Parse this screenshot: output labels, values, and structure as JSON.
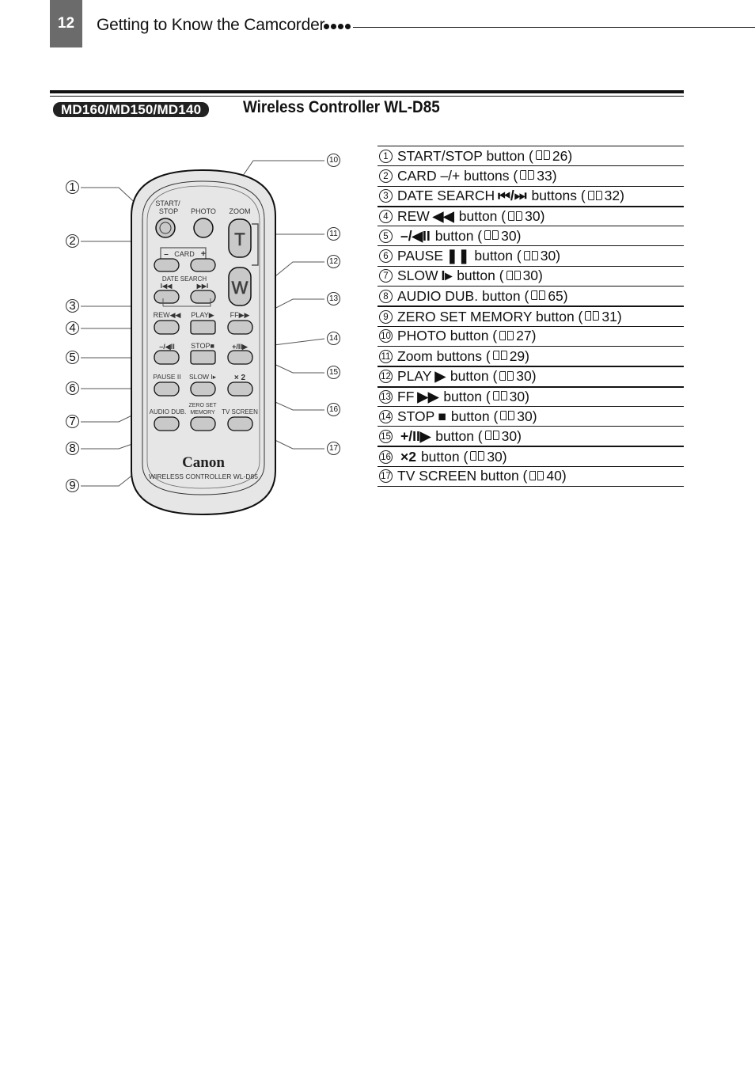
{
  "header": {
    "page_number": "12",
    "running_head": "Getting to Know the Camcorder"
  },
  "section": {
    "model_badge": "MD160/MD150/MD140",
    "title": "Wireless Controller WL-D85"
  },
  "items": [
    {
      "num": "1",
      "pre": "START/STOP button (",
      "symbol": "",
      "post": "",
      "page": "26"
    },
    {
      "num": "2",
      "pre": "CARD –/+ buttons (",
      "symbol": "",
      "post": "",
      "page": "33"
    },
    {
      "num": "3",
      "pre": "DATE SEARCH",
      "symbol": "⏮/⏭",
      "post": "buttons (",
      "page": "32"
    },
    {
      "num": "4",
      "pre": "REW",
      "symbol": "◀◀",
      "post": "button (",
      "page": "30"
    },
    {
      "num": "5",
      "pre": "",
      "symbol": "–/◀II",
      "post": "button (",
      "page": "30"
    },
    {
      "num": "6",
      "pre": "PAUSE",
      "symbol": "❚❚",
      "post": "button (",
      "page": "30"
    },
    {
      "num": "7",
      "pre": "SLOW",
      "symbol": "I▸",
      "post": "button (",
      "page": "30"
    },
    {
      "num": "8",
      "pre": "AUDIO DUB. button (",
      "symbol": "",
      "post": "",
      "page": "65"
    },
    {
      "num": "9",
      "pre": "ZERO SET MEMORY button (",
      "symbol": "",
      "post": "",
      "page": "31"
    },
    {
      "num": "10",
      "pre": "PHOTO button (",
      "symbol": "",
      "post": "",
      "page": "27"
    },
    {
      "num": "11",
      "pre": "Zoom buttons (",
      "symbol": "",
      "post": "",
      "page": "29"
    },
    {
      "num": "12",
      "pre": "PLAY",
      "symbol": "▶",
      "post": "button (",
      "page": "30"
    },
    {
      "num": "13",
      "pre": "FF",
      "symbol": "▶▶",
      "post": "button (",
      "page": "30"
    },
    {
      "num": "14",
      "pre": "STOP",
      "symbol": "■",
      "post": "button (",
      "page": "30"
    },
    {
      "num": "15",
      "pre": "",
      "symbol": "+/II▶",
      "post": "button (",
      "page": "30"
    },
    {
      "num": "16",
      "pre": "",
      "symbol": "×2",
      "post": "button (",
      "page": "30"
    },
    {
      "num": "17",
      "pre": "TV SCREEN button (",
      "symbol": "",
      "post": "",
      "page": "40"
    }
  ],
  "remote": {
    "labels": {
      "start_stop_1": "START/",
      "start_stop_2": "STOP",
      "photo": "PHOTO",
      "zoom": "ZOOM",
      "zoom_t": "T",
      "zoom_w": "W",
      "card": "CARD",
      "card_minus": "–",
      "card_plus": "+",
      "date_search": "DATE SEARCH",
      "date_prev": "I◀◀",
      "date_next": "▶▶I",
      "rew": "REW◀◀",
      "play": "PLAY▶",
      "ff": "FF▶▶",
      "minus_rev": "–/◀II",
      "stop": "STOP■",
      "plus_fwd": "+/II▶",
      "pause": "PAUSE II",
      "slow": "SLOW I▸",
      "x2": "× 2",
      "audio_dub": "AUDIO DUB.",
      "zero_set_1": "ZERO SET",
      "zero_set_2": "MEMORY",
      "tv_screen": "TV SCREEN",
      "brand": "Canon",
      "model": "WIRELESS CONTROLLER WL-D85"
    },
    "callouts": [
      "1",
      "2",
      "3",
      "4",
      "5",
      "6",
      "7",
      "8",
      "9",
      "10",
      "11",
      "12",
      "13",
      "14",
      "15",
      "16",
      "17"
    ]
  }
}
